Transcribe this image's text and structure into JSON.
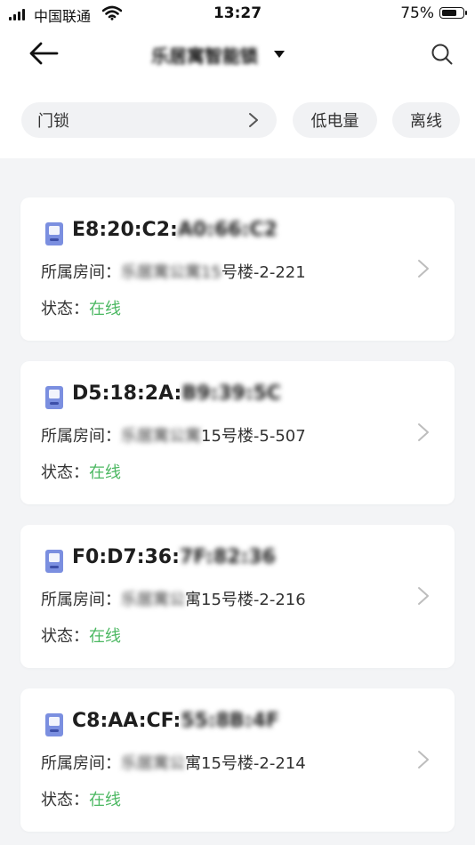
{
  "status_bar": {
    "carrier": "中国联通",
    "time": "13:27",
    "battery_percent": "75%",
    "battery_level": 0.75
  },
  "nav": {
    "title": "乐居寓智能锁",
    "title_dropdown_icon": "caret-down-icon",
    "back_icon": "arrow-left-icon",
    "search_icon": "search-icon"
  },
  "filters": {
    "category": "门锁",
    "low_battery": "低电量",
    "offline": "离线"
  },
  "labels": {
    "room": "所属房间：",
    "status": "状态："
  },
  "colors": {
    "online": "#4cb862",
    "device_icon": "#7b8fe0"
  },
  "devices": [
    {
      "mac_visible": "E8:20:C2:",
      "mac_masked": "A0:66:C2",
      "room_masked": "乐居寓公寓15",
      "room_visible": "号楼-2-221",
      "status": "在线"
    },
    {
      "mac_visible": "D5:18:2A:",
      "mac_masked": "B9:39:5C",
      "room_masked": "乐居寓公寓",
      "room_visible": "15号楼-5-507",
      "status": "在线"
    },
    {
      "mac_visible": "F0:D7:36:",
      "mac_masked": "7F:82:36",
      "room_masked": "乐居寓公",
      "room_visible": "寓15号楼-2-216",
      "status": "在线"
    },
    {
      "mac_visible": "C8:AA:CF:",
      "mac_masked": "55:8B:4F",
      "room_masked": "乐居寓公",
      "room_visible": "寓15号楼-2-214",
      "status": "在线"
    }
  ]
}
